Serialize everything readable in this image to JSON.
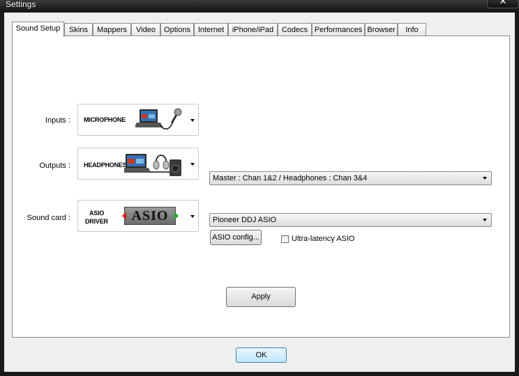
{
  "window": {
    "title": "Settings",
    "close_glyph": "✕"
  },
  "tabs": [
    {
      "label": "Sound Setup",
      "active": true
    },
    {
      "label": "Skins"
    },
    {
      "label": "Mappers"
    },
    {
      "label": "Video"
    },
    {
      "label": "Options"
    },
    {
      "label": "Internet"
    },
    {
      "label": "iPhone/iPad"
    },
    {
      "label": "Codecs"
    },
    {
      "label": "Performances"
    },
    {
      "label": "Browser"
    },
    {
      "label": "Info"
    }
  ],
  "sound_setup": {
    "inputs": {
      "label": "Inputs :",
      "device": "MICROPHONE",
      "icon": "laptop-microphone-icon"
    },
    "outputs": {
      "label": "Outputs :",
      "device": "HEADPHONES",
      "icon": "laptop-headphones-speaker-icon",
      "routing": "Master : Chan 1&2 / Headphones : Chan 3&4"
    },
    "sound_card": {
      "label": "Sound card :",
      "device_line1": "ASIO",
      "device_line2": "DRIVER",
      "logo_text": "ASIO",
      "selected": "Pioneer DDJ ASIO",
      "config_button": "ASIO config...",
      "ultra_latency": {
        "label": "Ultra-latency ASIO",
        "checked": false
      }
    },
    "apply_button": "Apply"
  },
  "footer": {
    "ok_button": "OK"
  }
}
